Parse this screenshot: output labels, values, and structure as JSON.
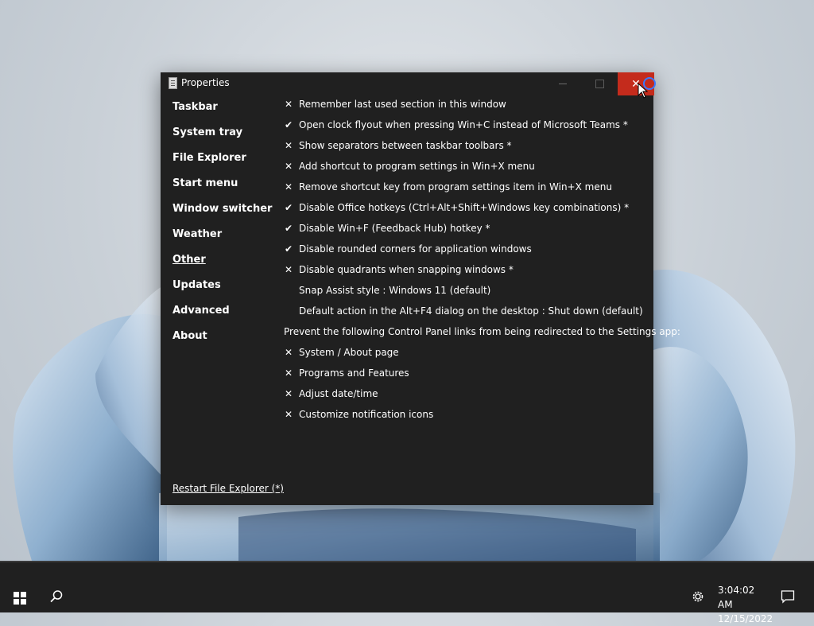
{
  "window": {
    "title": "Properties",
    "close_glyph": "✕"
  },
  "sidebar": {
    "items": [
      {
        "label": "Taskbar"
      },
      {
        "label": "System tray"
      },
      {
        "label": "File Explorer"
      },
      {
        "label": "Start menu"
      },
      {
        "label": "Window switcher"
      },
      {
        "label": "Weather"
      },
      {
        "label": "Other",
        "active": true
      },
      {
        "label": "Updates"
      },
      {
        "label": "Advanced"
      },
      {
        "label": "About"
      }
    ]
  },
  "settings": {
    "rows": [
      {
        "mark": "✕",
        "text": "Remember last used section in this window"
      },
      {
        "mark": "✔",
        "text": "Open clock flyout when pressing Win+C instead of Microsoft Teams *"
      },
      {
        "mark": "✕",
        "text": "Show separators between taskbar toolbars *"
      },
      {
        "mark": "✕",
        "text": "Add shortcut to program settings in Win+X menu"
      },
      {
        "mark": "✕",
        "text": "Remove shortcut key from program settings item in Win+X menu"
      },
      {
        "mark": "✔",
        "text": "Disable Office hotkeys (Ctrl+Alt+Shift+Windows key combinations) *"
      },
      {
        "mark": "✔",
        "text": "Disable Win+F (Feedback Hub) hotkey *"
      },
      {
        "mark": "✔",
        "text": "Disable rounded corners for application windows"
      },
      {
        "mark": "✕",
        "text": "Disable quadrants when snapping windows *"
      },
      {
        "mark": "",
        "text": "Snap Assist style : Windows 11 (default)"
      },
      {
        "mark": "",
        "text": "Default action in the Alt+F4 dialog on the desktop : Shut down (default)"
      },
      {
        "mark": "",
        "text": "Prevent the following Control Panel links from being redirected to the Settings app:"
      },
      {
        "mark": "✕",
        "text": "System / About page"
      },
      {
        "mark": "✕",
        "text": "Programs and Features"
      },
      {
        "mark": "✕",
        "text": "Adjust date/time"
      },
      {
        "mark": "✕",
        "text": "Customize notification icons"
      }
    ]
  },
  "footer": {
    "restart_label": "Restart File Explorer (*)"
  },
  "taskbar": {
    "time": "3:04:02 AM",
    "date": "12/15/2022"
  },
  "colors": {
    "window_bg": "#202020",
    "close_red": "#c42b1c",
    "cursor_ring": "#3a78ff"
  }
}
